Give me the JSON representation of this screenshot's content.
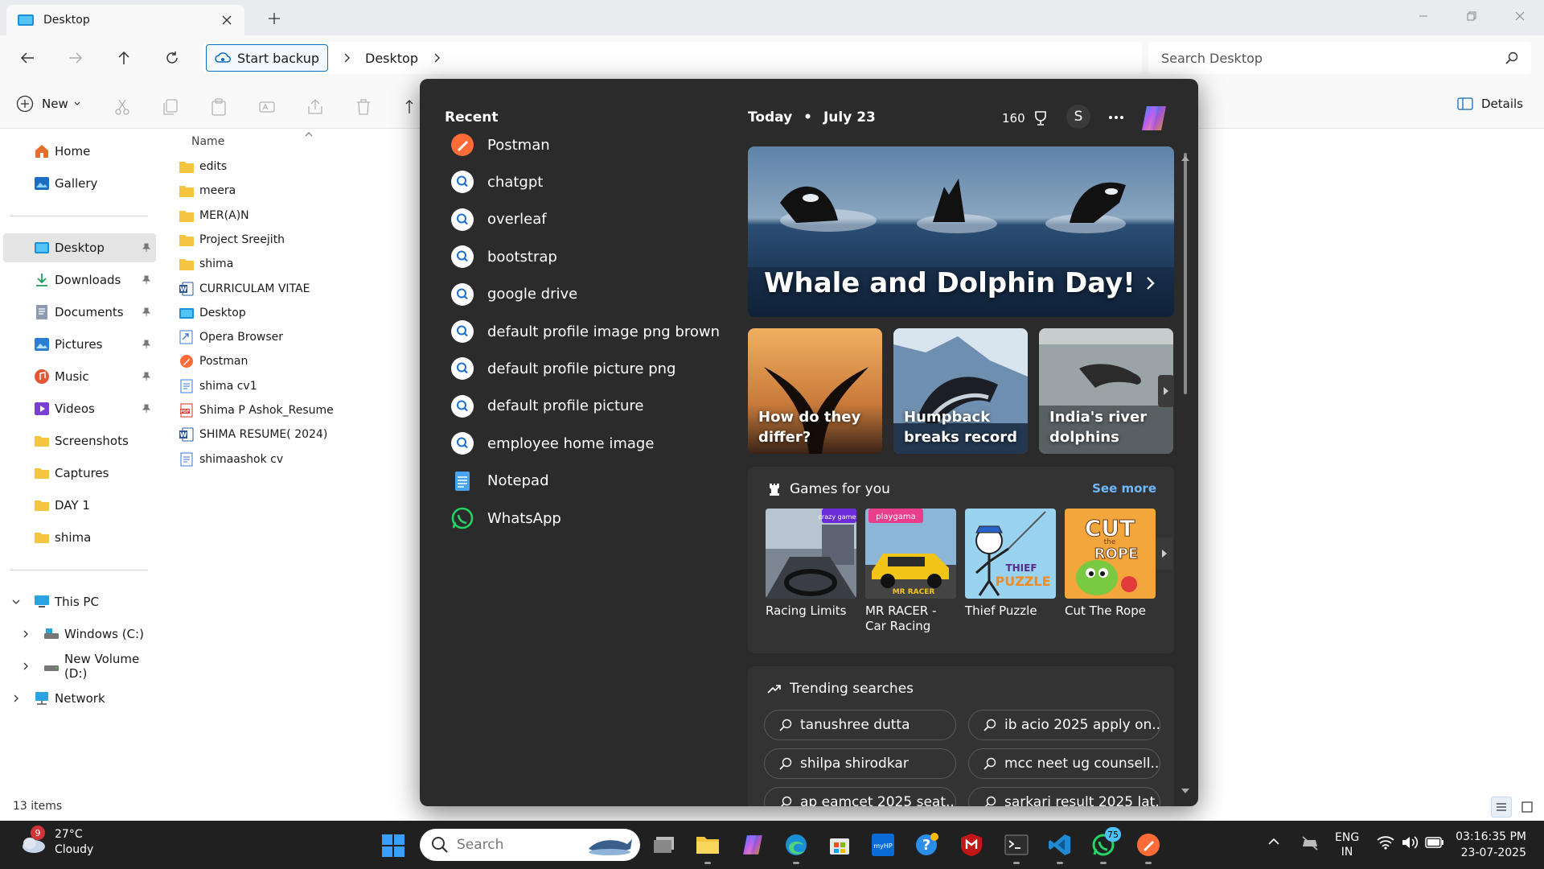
{
  "window": {
    "tab_title": "Desktop",
    "accent": "#0f6cbd"
  },
  "address": {
    "backup_label": "Start backup",
    "crumb": "Desktop",
    "search_placeholder": "Search Desktop"
  },
  "commandbar": {
    "new_label": "New",
    "details_label": "Details"
  },
  "nav": {
    "items": [
      {
        "label": "Home",
        "icon": "home-icon"
      },
      {
        "label": "Gallery",
        "icon": "gallery-icon"
      },
      {
        "label": "Desktop",
        "icon": "desktop-folder-icon"
      },
      {
        "label": "Downloads",
        "icon": "download-icon"
      },
      {
        "label": "Documents",
        "icon": "documents-icon"
      },
      {
        "label": "Pictures",
        "icon": "pictures-icon"
      },
      {
        "label": "Music",
        "icon": "music-icon"
      },
      {
        "label": "Videos",
        "icon": "videos-icon"
      },
      {
        "label": "Screenshots",
        "icon": "folder-icon"
      },
      {
        "label": "Captures",
        "icon": "folder-icon"
      },
      {
        "label": "DAY 1",
        "icon": "folder-icon"
      },
      {
        "label": "shima",
        "icon": "folder-icon"
      },
      {
        "label": "This PC",
        "icon": "pc-icon"
      },
      {
        "label": "Windows (C:)",
        "icon": "drive-icon"
      },
      {
        "label": "New Volume (D:)",
        "icon": "drive-icon"
      },
      {
        "label": "Network",
        "icon": "network-icon"
      }
    ]
  },
  "files": {
    "column_name": "Name",
    "items": [
      {
        "name": "edits",
        "type": "folder"
      },
      {
        "name": "meera",
        "type": "folder"
      },
      {
        "name": "MER(A)N",
        "type": "folder"
      },
      {
        "name": "Project Sreejith",
        "type": "folder"
      },
      {
        "name": "shima",
        "type": "folder"
      },
      {
        "name": "CURRICULAM VITAE",
        "type": "word"
      },
      {
        "name": "Desktop",
        "type": "desktop"
      },
      {
        "name": "Opera Browser",
        "type": "shortcut"
      },
      {
        "name": "Postman",
        "type": "postman"
      },
      {
        "name": "shima cv1",
        "type": "doc"
      },
      {
        "name": "Shima P Ashok_Resume",
        "type": "pdf"
      },
      {
        "name": "SHIMA RESUME( 2024)",
        "type": "word"
      },
      {
        "name": "shimaashok cv",
        "type": "doc"
      }
    ],
    "count_label": "13 items"
  },
  "search_panel": {
    "recent_title": "Recent",
    "recent": [
      {
        "label": "Postman",
        "icon": "postman-icon"
      },
      {
        "label": "chatgpt",
        "icon": "search-icon"
      },
      {
        "label": "overleaf",
        "icon": "search-icon"
      },
      {
        "label": "bootstrap",
        "icon": "search-icon"
      },
      {
        "label": "google drive",
        "icon": "search-icon"
      },
      {
        "label": "default profile image png brown",
        "icon": "search-icon"
      },
      {
        "label": "default profile picture png",
        "icon": "search-icon"
      },
      {
        "label": "default profile picture",
        "icon": "search-icon"
      },
      {
        "label": "employee home image",
        "icon": "search-icon"
      },
      {
        "label": "Notepad",
        "icon": "notepad-icon"
      },
      {
        "label": "WhatsApp",
        "icon": "whatsapp-icon"
      }
    ],
    "today_label": "Today",
    "date_label": "July 23",
    "points": "160",
    "avatar_letter": "S",
    "hero_title": "Whale and Dolphin Day!",
    "cards": [
      {
        "title": "How do they differ?"
      },
      {
        "title": "Humpback breaks record"
      },
      {
        "title": "India's river dolphins"
      }
    ],
    "games_title": "Games for you",
    "see_more": "See more",
    "games": [
      {
        "name": "Racing Limits"
      },
      {
        "name": "MR RACER - Car Racing"
      },
      {
        "name": "Thief Puzzle"
      },
      {
        "name": "Cut The Rope"
      }
    ],
    "game_thumb_text": {
      "playgama": "playgama",
      "crazy": "crazy games",
      "mr_racer": "MR RACER",
      "thief": "THIEF",
      "puzzle": "PUZZLE",
      "cut": "CUT",
      "the": "the",
      "rope": "ROPE"
    },
    "trending_title": "Trending searches",
    "trending": [
      "tanushree dutta",
      "ib acio 2025 apply on...",
      "shilpa shirodkar",
      "mcc neet ug counsell...",
      "ap eamcet 2025 seat...",
      "sarkari result 2025 lat..."
    ]
  },
  "taskbar": {
    "weather_temp": "27°C",
    "weather_desc": "Cloudy",
    "weather_badge": "9",
    "search_placeholder": "Search",
    "lang_top": "ENG",
    "lang_bottom": "IN",
    "time": "03:16:35 PM",
    "date": "23-07-2025",
    "edge_badge": "75",
    "apps": [
      "task-view-icon",
      "file-explorer-icon",
      "copilot-icon",
      "edge-icon",
      "store-icon",
      "myhp-icon",
      "help-icon",
      "mcafee-icon",
      "terminal-icon",
      "vscode-icon",
      "whatsapp-icon",
      "postman-icon"
    ]
  }
}
